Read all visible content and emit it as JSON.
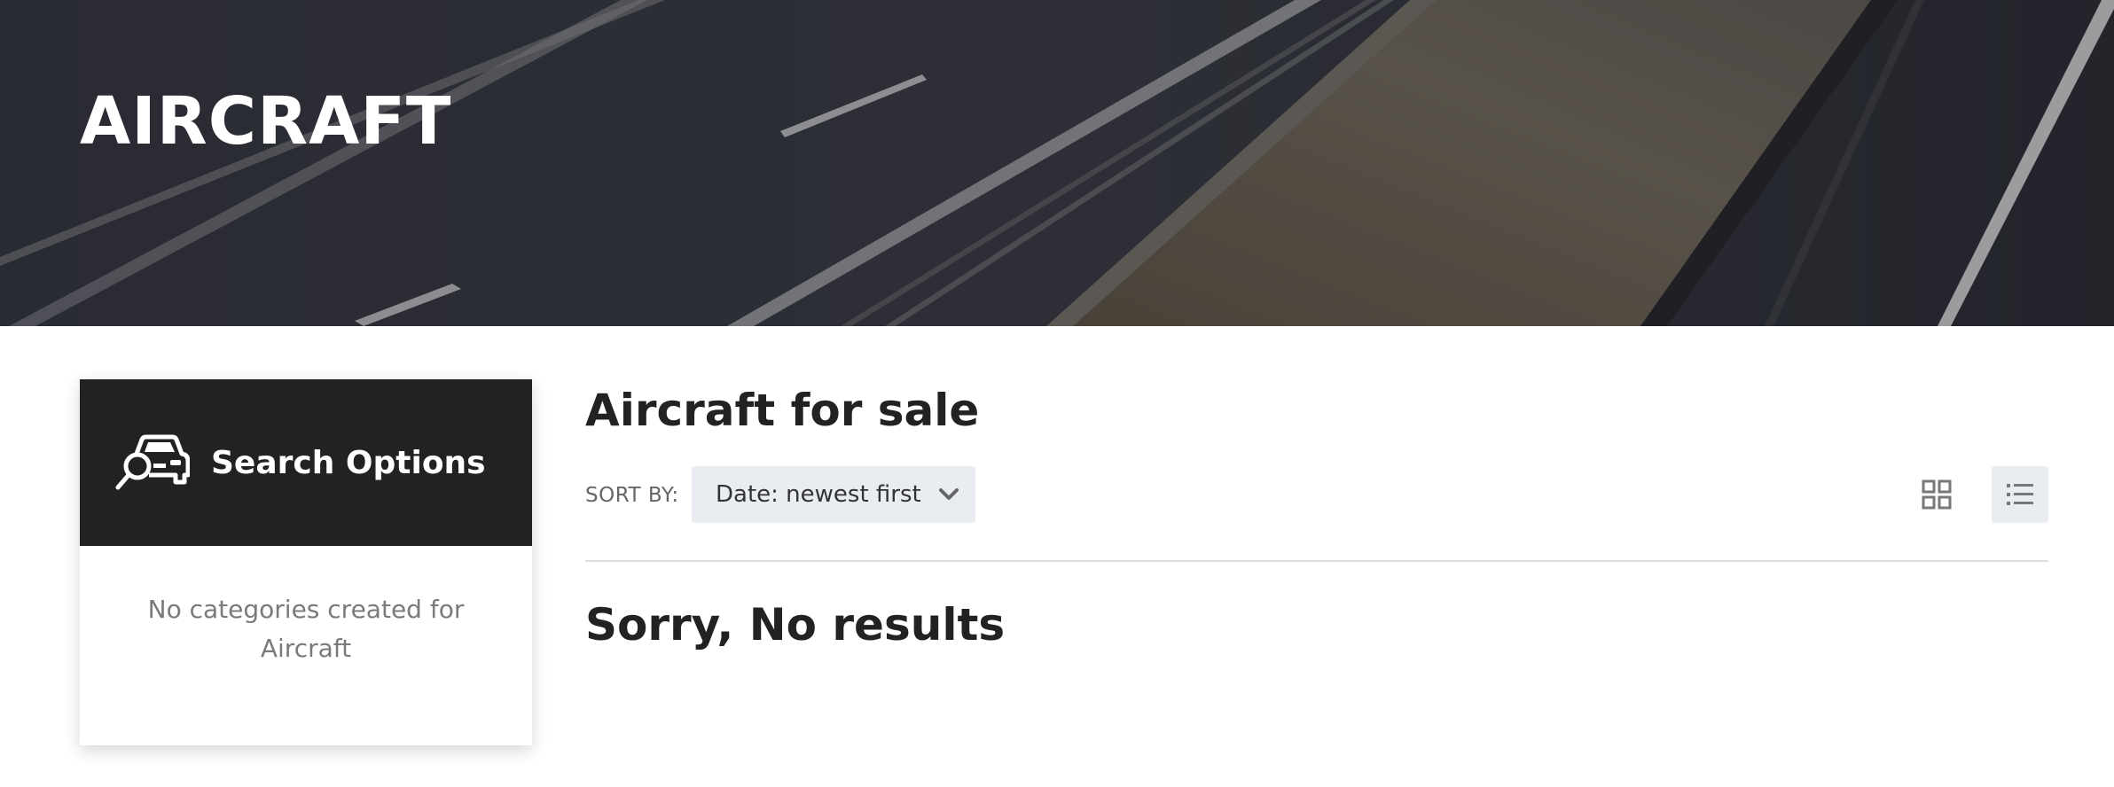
{
  "hero": {
    "title": "AIRCRAFT"
  },
  "sidebar": {
    "title": "Search Options",
    "icon": "car-search-icon",
    "empty_message": "No categories created for Aircraft"
  },
  "main": {
    "title": "Aircraft for sale",
    "sort_label": "SORT BY:",
    "sort_value": "Date: newest first",
    "view_modes": [
      "grid-view-icon",
      "list-view-icon"
    ],
    "active_view": "list",
    "no_results": "Sorry, No results"
  },
  "colors": {
    "hero_overlay": "#2b2d33",
    "sidebar_header": "#222222",
    "control_bg": "#e9edf1",
    "text_dark": "#222222",
    "text_muted": "#7a7a7a"
  }
}
